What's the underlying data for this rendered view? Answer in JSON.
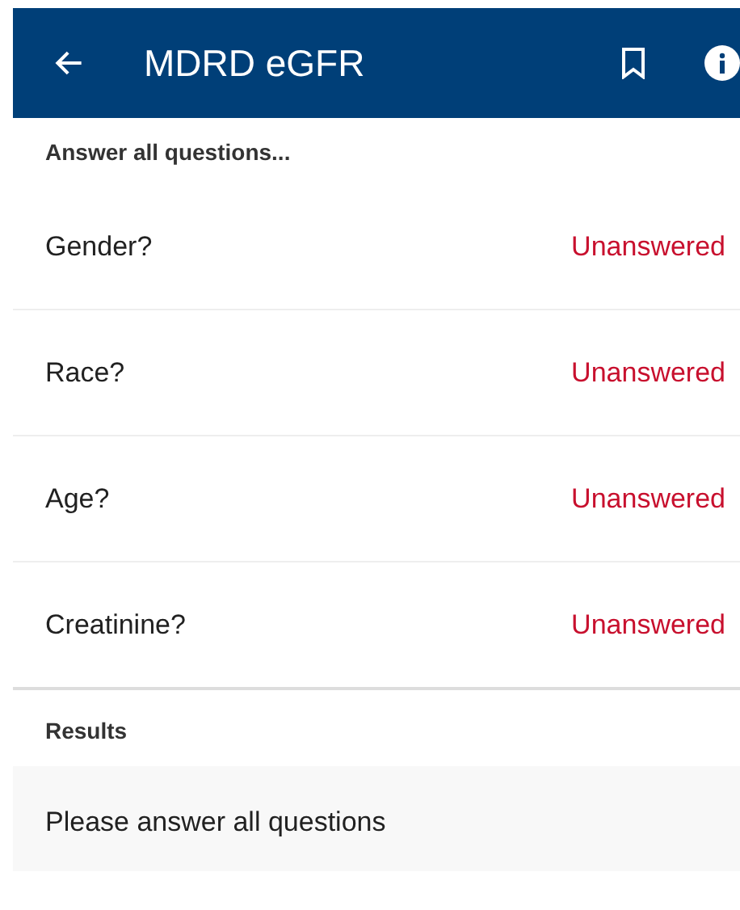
{
  "header": {
    "title": "MDRD eGFR"
  },
  "questions_heading": "Answer all questions...",
  "questions": [
    {
      "label": "Gender?",
      "status": "Unanswered"
    },
    {
      "label": "Race?",
      "status": "Unanswered"
    },
    {
      "label": "Age?",
      "status": "Unanswered"
    },
    {
      "label": "Creatinine?",
      "status": "Unanswered"
    }
  ],
  "results": {
    "heading": "Results",
    "message": "Please answer all questions"
  }
}
